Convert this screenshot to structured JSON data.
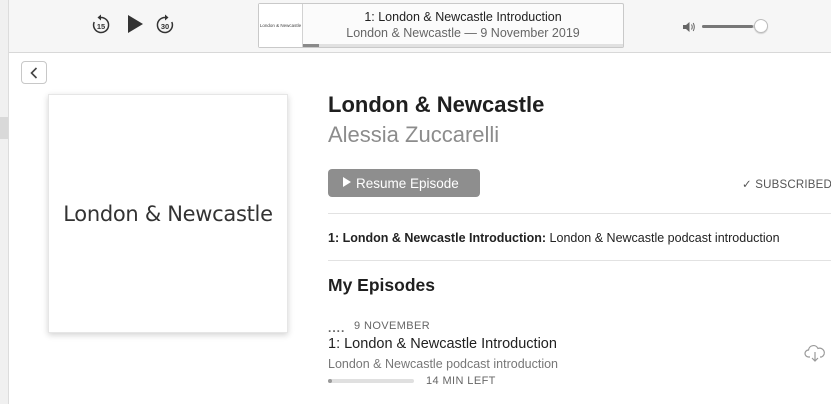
{
  "player": {
    "skip_back_seconds": "15",
    "skip_forward_seconds": "30",
    "now_playing_title": "1: London & Newcastle Introduction",
    "now_playing_subtitle": "London & Newcastle — 9 November 2019",
    "now_playing_art_text": "London & Newcastle",
    "playback_progress": 0.05,
    "volume_level": 0.85
  },
  "podcast": {
    "artwork_text": "London & Newcastle",
    "title": "London & Newcastle",
    "author": "Alessia Zuccarelli",
    "resume_label": "Resume Episode",
    "subscribed_label": "✓ SUBSCRIBED",
    "featured_episode_title": "1: London & Newcastle Introduction:",
    "featured_episode_desc": "London & Newcastle podcast introduction"
  },
  "episodes_section": {
    "title": "My Episodes",
    "items": [
      {
        "status_dots": "....",
        "date": "9 NOVEMBER",
        "title": "1: London & Newcastle Introduction",
        "description": "London & Newcastle podcast introduction",
        "progress": 0.05,
        "time_left": "14 MIN LEFT"
      }
    ]
  },
  "colors": {
    "toolbar_bg": "#f6f6f6",
    "button_gray": "#8e8e8e",
    "secondary_text": "#8c8c8c"
  },
  "icons": [
    "skip-back-15-icon",
    "play-icon",
    "skip-forward-30-icon",
    "volume-icon",
    "chevron-left-icon",
    "cloud-download-icon"
  ]
}
